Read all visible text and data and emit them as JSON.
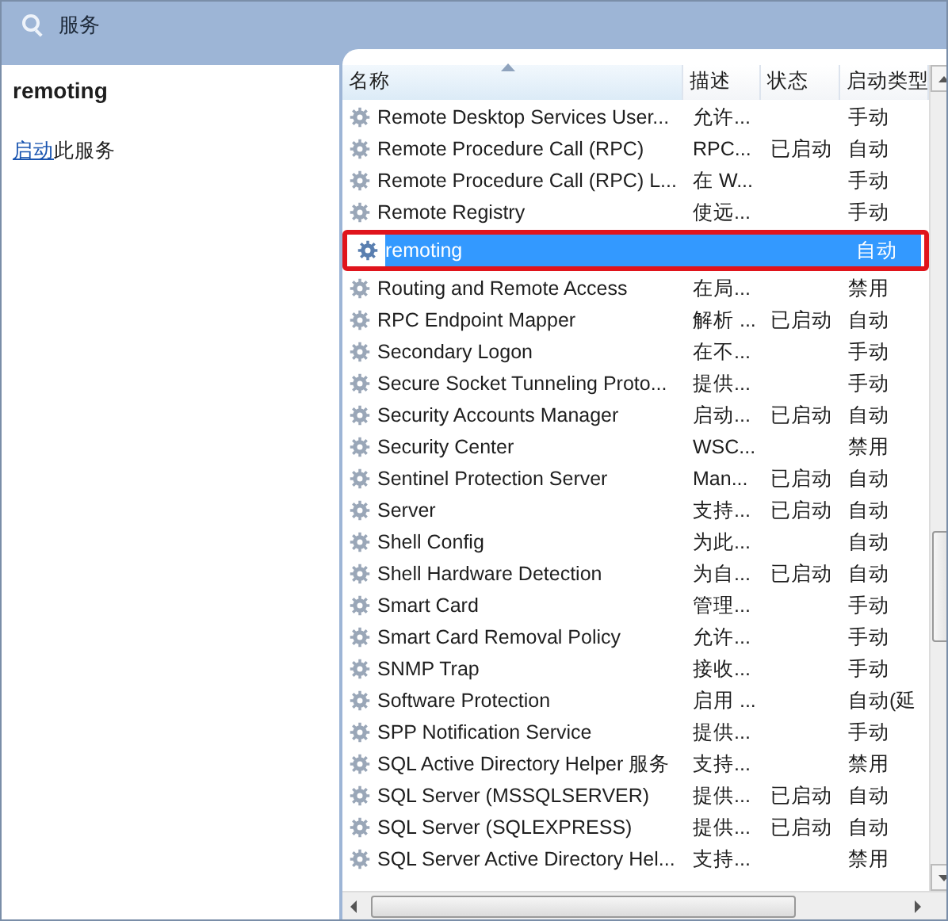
{
  "window": {
    "title": "服务"
  },
  "detail": {
    "service_name": "remoting",
    "action_link": "启动",
    "action_text": "此服务"
  },
  "table": {
    "columns": [
      {
        "label": "名称",
        "sorted": true
      },
      {
        "label": "描述",
        "sorted": false
      },
      {
        "label": "状态",
        "sorted": false
      },
      {
        "label": "启动类型",
        "sorted": false
      }
    ],
    "rows": [
      {
        "name": "Remote Desktop Services User...",
        "description": "允许...",
        "status": "",
        "startup": "手动",
        "selected": false,
        "highlighted": false
      },
      {
        "name": "Remote Procedure Call (RPC)",
        "description": "RPC...",
        "status": "已启动",
        "startup": "自动",
        "selected": false,
        "highlighted": false
      },
      {
        "name": "Remote Procedure Call (RPC) L...",
        "description": "在 W...",
        "status": "",
        "startup": "手动",
        "selected": false,
        "highlighted": false
      },
      {
        "name": "Remote Registry",
        "description": "使远...",
        "status": "",
        "startup": "手动",
        "selected": false,
        "highlighted": false
      },
      {
        "name": "remoting",
        "description": "",
        "status": "",
        "startup": "自动",
        "selected": true,
        "highlighted": true
      },
      {
        "name": "Routing and Remote Access",
        "description": "在局...",
        "status": "",
        "startup": "禁用",
        "selected": false,
        "highlighted": false
      },
      {
        "name": "RPC Endpoint Mapper",
        "description": "解析 ...",
        "status": "已启动",
        "startup": "自动",
        "selected": false,
        "highlighted": false
      },
      {
        "name": "Secondary Logon",
        "description": "在不...",
        "status": "",
        "startup": "手动",
        "selected": false,
        "highlighted": false
      },
      {
        "name": "Secure Socket Tunneling Proto...",
        "description": "提供...",
        "status": "",
        "startup": "手动",
        "selected": false,
        "highlighted": false
      },
      {
        "name": "Security Accounts Manager",
        "description": "启动...",
        "status": "已启动",
        "startup": "自动",
        "selected": false,
        "highlighted": false
      },
      {
        "name": "Security Center",
        "description": "WSC...",
        "status": "",
        "startup": "禁用",
        "selected": false,
        "highlighted": false
      },
      {
        "name": "Sentinel Protection Server",
        "description": "Man...",
        "status": "已启动",
        "startup": "自动",
        "selected": false,
        "highlighted": false
      },
      {
        "name": "Server",
        "description": "支持...",
        "status": "已启动",
        "startup": "自动",
        "selected": false,
        "highlighted": false
      },
      {
        "name": "Shell Config",
        "description": "为此...",
        "status": "",
        "startup": "自动",
        "selected": false,
        "highlighted": false
      },
      {
        "name": "Shell Hardware Detection",
        "description": "为自...",
        "status": "已启动",
        "startup": "自动",
        "selected": false,
        "highlighted": false
      },
      {
        "name": "Smart Card",
        "description": "管理...",
        "status": "",
        "startup": "手动",
        "selected": false,
        "highlighted": false
      },
      {
        "name": "Smart Card Removal Policy",
        "description": "允许...",
        "status": "",
        "startup": "手动",
        "selected": false,
        "highlighted": false
      },
      {
        "name": "SNMP Trap",
        "description": "接收...",
        "status": "",
        "startup": "手动",
        "selected": false,
        "highlighted": false
      },
      {
        "name": "Software Protection",
        "description": "启用 ...",
        "status": "",
        "startup": "自动(延",
        "selected": false,
        "highlighted": false
      },
      {
        "name": "SPP Notification Service",
        "description": "提供...",
        "status": "",
        "startup": "手动",
        "selected": false,
        "highlighted": false
      },
      {
        "name": "SQL Active Directory Helper 服务",
        "description": "支持...",
        "status": "",
        "startup": "禁用",
        "selected": false,
        "highlighted": false
      },
      {
        "name": "SQL Server (MSSQLSERVER)",
        "description": "提供...",
        "status": "已启动",
        "startup": "自动",
        "selected": false,
        "highlighted": false
      },
      {
        "name": "SQL Server (SQLEXPRESS)",
        "description": "提供...",
        "status": "已启动",
        "startup": "自动",
        "selected": false,
        "highlighted": false
      },
      {
        "name": "SQL Server Active Directory Hel...",
        "description": "支持...",
        "status": "",
        "startup": "禁用",
        "selected": false,
        "highlighted": false
      }
    ]
  }
}
